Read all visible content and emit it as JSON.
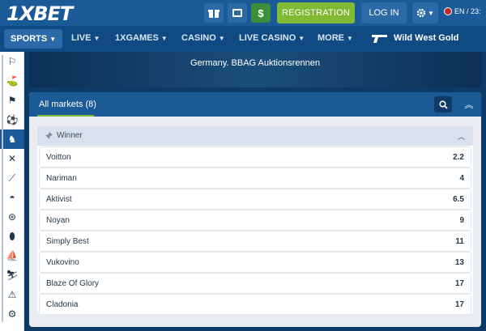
{
  "header": {
    "logo": "1XBET",
    "registration_label": "REGISTRATION",
    "login_label": "LOG IN",
    "lang_label": "EN / 23:"
  },
  "nav": {
    "items": [
      {
        "label": "SPORTS"
      },
      {
        "label": "LIVE"
      },
      {
        "label": "1XGAMES"
      },
      {
        "label": "CASINO"
      },
      {
        "label": "LIVE CASINO"
      },
      {
        "label": "MORE"
      }
    ],
    "promo_label": "Wild West Gold"
  },
  "event": {
    "title": "Germany. BBAG Auktionsrennen"
  },
  "markets": {
    "title": "All markets (8)",
    "group_title": "Winner",
    "rows": [
      {
        "name": "Voitton",
        "odds": "2.2"
      },
      {
        "name": "Nariman",
        "odds": "4"
      },
      {
        "name": "Aktivist",
        "odds": "6.5"
      },
      {
        "name": "Noyan",
        "odds": "9"
      },
      {
        "name": "Simply Best",
        "odds": "11"
      },
      {
        "name": "Vukovino",
        "odds": "13"
      },
      {
        "name": "Blaze Of Glory",
        "odds": "17"
      },
      {
        "name": "Cladonia",
        "odds": "17"
      }
    ]
  },
  "sidebar": {
    "icons": [
      "horse-flag-icon",
      "golf-flag-icon",
      "racing-flag-icon",
      "football-icon",
      "trotting-icon",
      "lacrosse-icon",
      "badminton-icon",
      "helmet-icon",
      "steering-wheel-icon",
      "rugby-ball-icon",
      "sailing-icon",
      "skiing-icon",
      "warning-triangle-icon",
      "motorbike-icon"
    ]
  }
}
